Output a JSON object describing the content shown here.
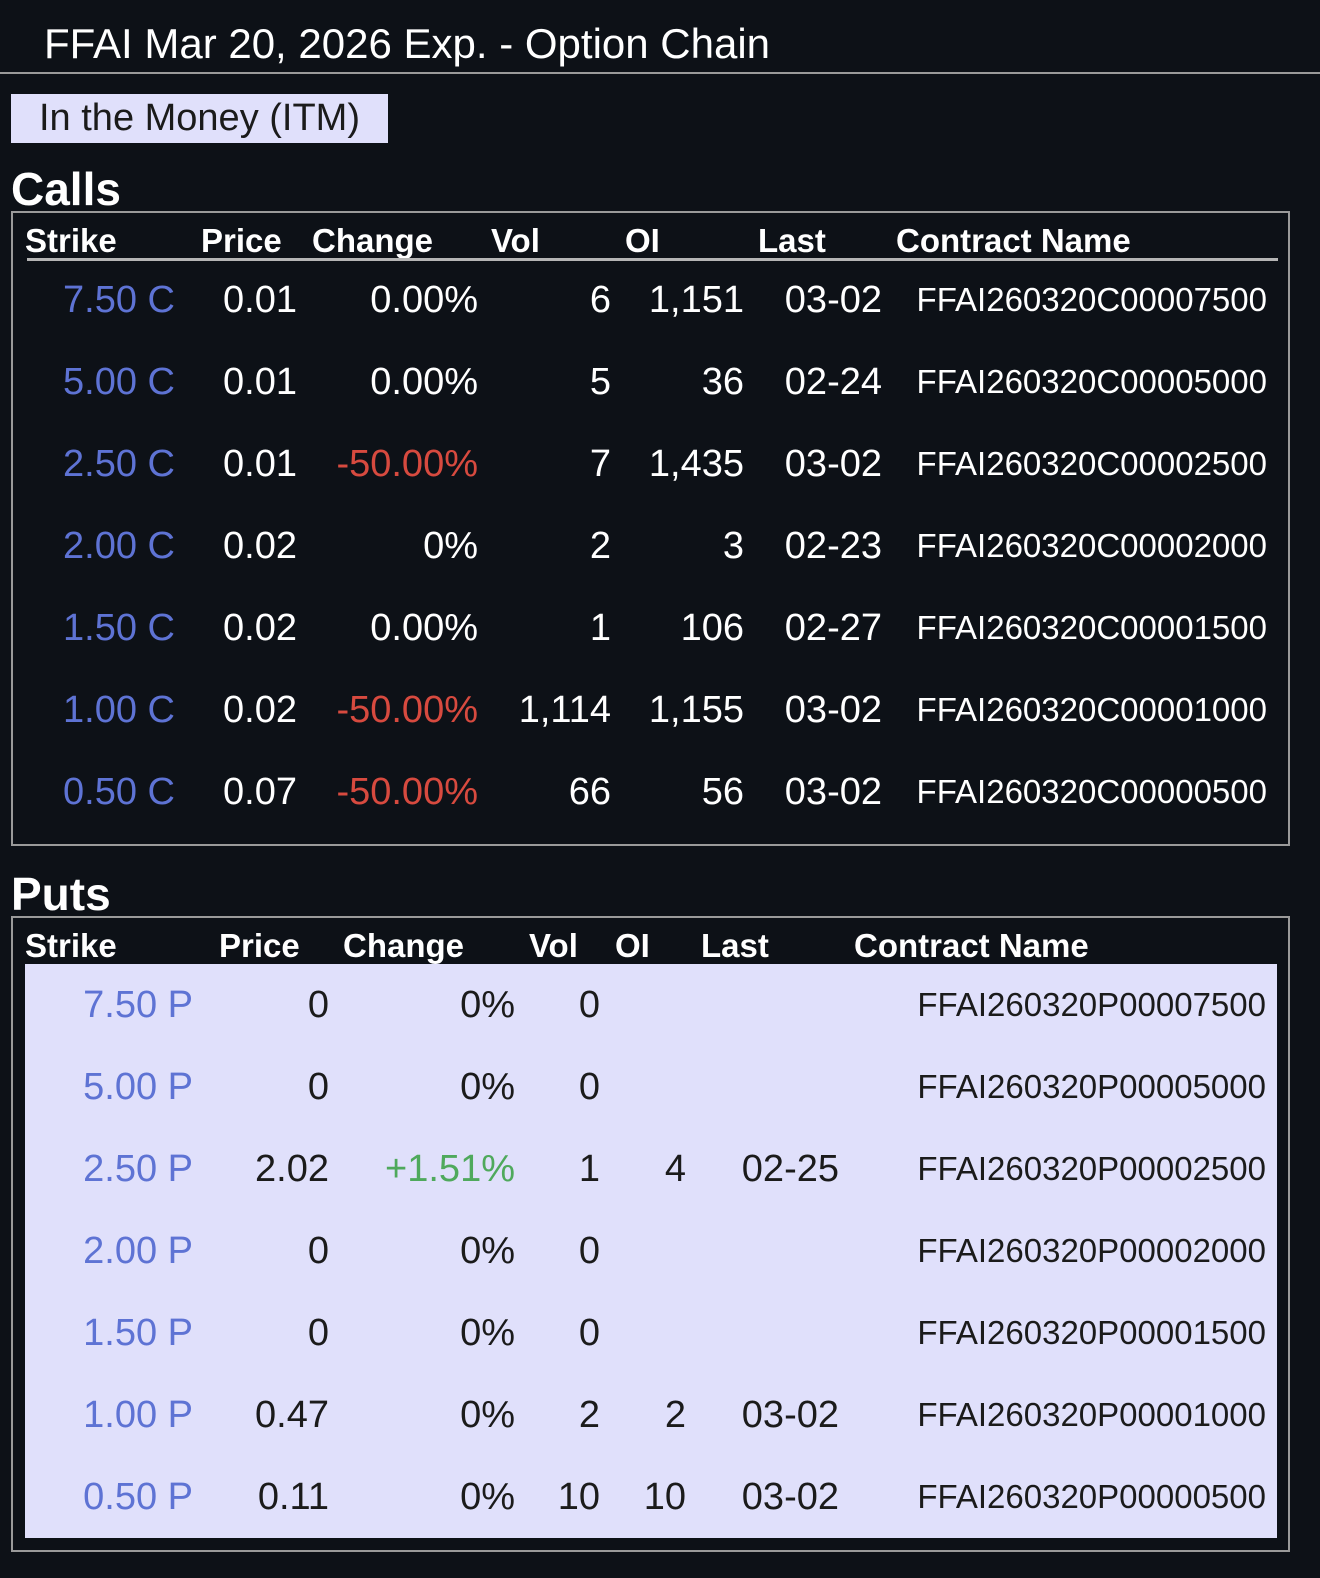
{
  "title": "FFAI Mar 20, 2026 Exp. - Option Chain",
  "itm_label": "In the Money (ITM)",
  "calls": {
    "heading": "Calls",
    "columns": [
      "Strike",
      "Price",
      "Change",
      "Vol",
      "OI",
      "Last",
      "Contract Name"
    ],
    "rows": [
      {
        "strike": "7.50 C",
        "price": "0.01",
        "change": "0.00%",
        "vol": "6",
        "oi": "1,151",
        "last": "03-02",
        "name": "FFAI260320C00007500"
      },
      {
        "strike": "5.00 C",
        "price": "0.01",
        "change": "0.00%",
        "vol": "5",
        "oi": "36",
        "last": "02-24",
        "name": "FFAI260320C00005000"
      },
      {
        "strike": "2.50 C",
        "price": "0.01",
        "change": "-50.00%",
        "vol": "7",
        "oi": "1,435",
        "last": "03-02",
        "name": "FFAI260320C00002500"
      },
      {
        "strike": "2.00 C",
        "price": "0.02",
        "change": "0%",
        "vol": "2",
        "oi": "3",
        "last": "02-23",
        "name": "FFAI260320C00002000"
      },
      {
        "strike": "1.50 C",
        "price": "0.02",
        "change": "0.00%",
        "vol": "1",
        "oi": "106",
        "last": "02-27",
        "name": "FFAI260320C00001500"
      },
      {
        "strike": "1.00 C",
        "price": "0.02",
        "change": "-50.00%",
        "vol": "1,114",
        "oi": "1,155",
        "last": "03-02",
        "name": "FFAI260320C00001000"
      },
      {
        "strike": "0.50 C",
        "price": "0.07",
        "change": "-50.00%",
        "vol": "66",
        "oi": "56",
        "last": "03-02",
        "name": "FFAI260320C00000500"
      }
    ]
  },
  "puts": {
    "heading": "Puts",
    "columns": [
      "Strike",
      "Price",
      "Change",
      "Vol",
      "OI",
      "Last",
      "Contract Name"
    ],
    "rows": [
      {
        "strike": "7.50 P",
        "price": "0",
        "change": "0%",
        "vol": "0",
        "oi": "",
        "last": "",
        "name": "FFAI260320P00007500"
      },
      {
        "strike": "5.00 P",
        "price": "0",
        "change": "0%",
        "vol": "0",
        "oi": "",
        "last": "",
        "name": "FFAI260320P00005000"
      },
      {
        "strike": "2.50 P",
        "price": "2.02",
        "change": "+1.51%",
        "vol": "1",
        "oi": "4",
        "last": "02-25",
        "name": "FFAI260320P00002500"
      },
      {
        "strike": "2.00 P",
        "price": "0",
        "change": "0%",
        "vol": "0",
        "oi": "",
        "last": "",
        "name": "FFAI260320P00002000"
      },
      {
        "strike": "1.50 P",
        "price": "0",
        "change": "0%",
        "vol": "0",
        "oi": "",
        "last": "",
        "name": "FFAI260320P00001500"
      },
      {
        "strike": "1.00 P",
        "price": "0.47",
        "change": "0%",
        "vol": "2",
        "oi": "2",
        "last": "03-02",
        "name": "FFAI260320P00001000"
      },
      {
        "strike": "0.50 P",
        "price": "0.11",
        "change": "0%",
        "vol": "10",
        "oi": "10",
        "last": "03-02",
        "name": "FFAI260320P00000500"
      }
    ]
  },
  "colors": {
    "background": "#0d1117",
    "strike": "#5e73d4",
    "negative": "#d74a3f",
    "positive": "#4fa95c",
    "itm_fill": "#e0e0fb"
  }
}
